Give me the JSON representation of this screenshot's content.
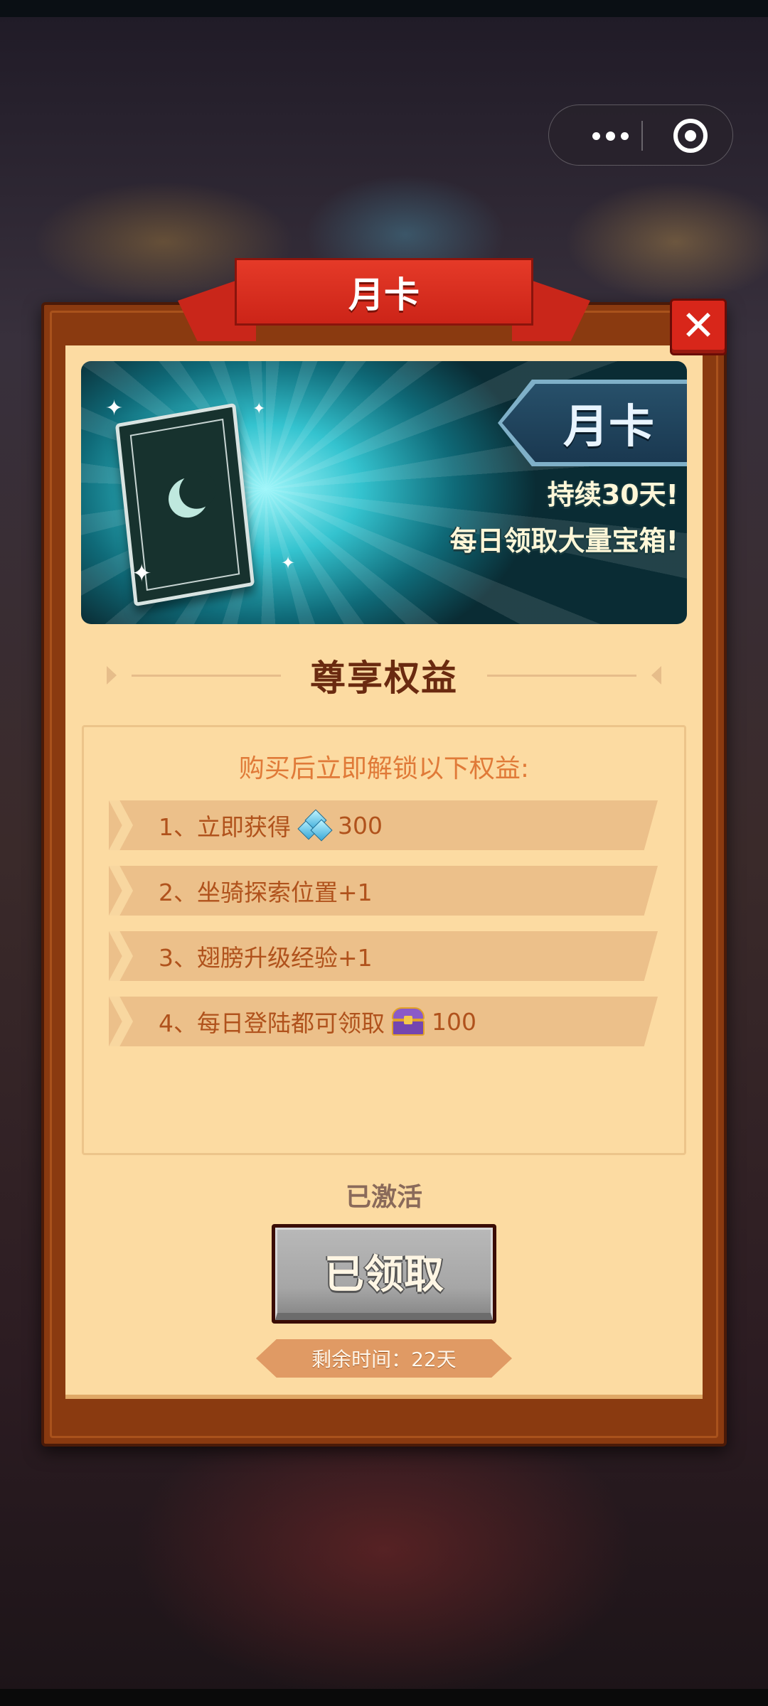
{
  "modal": {
    "title": "月卡",
    "close_glyph": "✕",
    "banner": {
      "tag": "月卡",
      "line1": "持续30天!",
      "line2": "每日领取大量宝箱!"
    },
    "section_title": "尊享权益",
    "benefits_intro": "购买后立即解锁以下权益:",
    "benefits": [
      {
        "prefix": "1、立即获得",
        "icon": "gem-icon",
        "value": "300"
      },
      {
        "prefix": "2、坐骑探索位置+1"
      },
      {
        "prefix": "3、翅膀升级经验+1"
      },
      {
        "prefix": "4、每日登陆都可领取",
        "icon": "chest-icon",
        "value": "100"
      }
    ],
    "status": "已激活",
    "claim_button": "已领取",
    "remaining_time": "剩余时间：22天"
  },
  "capsule": {
    "more_icon": "more-dots-icon",
    "close_icon": "target-circle-icon"
  }
}
